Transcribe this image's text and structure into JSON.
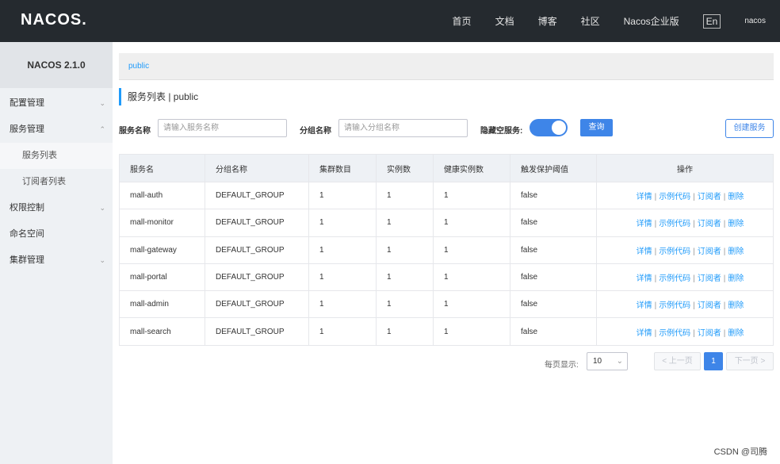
{
  "topbar": {
    "logo": "NACOS.",
    "nav": [
      "首页",
      "文档",
      "博客",
      "社区",
      "Nacos企业版"
    ],
    "lang": "En",
    "user": "nacos"
  },
  "sidebar": {
    "version": "NACOS 2.1.0",
    "items": [
      {
        "label": "配置管理",
        "chevron": "⌄"
      },
      {
        "label": "服务管理",
        "chevron": "⌃"
      },
      {
        "label": "服务列表"
      },
      {
        "label": "订阅者列表"
      },
      {
        "label": "权限控制",
        "chevron": "⌄"
      },
      {
        "label": "命名空间"
      },
      {
        "label": "集群管理",
        "chevron": "⌄"
      }
    ]
  },
  "main": {
    "breadcrumb": "public",
    "title": "服务列表 | public",
    "filters": {
      "service_label": "服务名称",
      "service_placeholder": "请输入服务名称",
      "group_label": "分组名称",
      "group_placeholder": "请输入分组名称",
      "hide_empty_label": "隐藏空服务:",
      "hide_empty_on": true,
      "query_button": "查询",
      "create_button": "创建服务"
    },
    "table": {
      "headers": [
        "服务名",
        "分组名称",
        "集群数目",
        "实例数",
        "健康实例数",
        "触发保护阈值",
        "操作"
      ],
      "rows": [
        [
          "mall-auth",
          "DEFAULT_GROUP",
          "1",
          "1",
          "1",
          "false"
        ],
        [
          "mall-monitor",
          "DEFAULT_GROUP",
          "1",
          "1",
          "1",
          "false"
        ],
        [
          "mall-gateway",
          "DEFAULT_GROUP",
          "1",
          "1",
          "1",
          "false"
        ],
        [
          "mall-portal",
          "DEFAULT_GROUP",
          "1",
          "1",
          "1",
          "false"
        ],
        [
          "mall-admin",
          "DEFAULT_GROUP",
          "1",
          "1",
          "1",
          "false"
        ],
        [
          "mall-search",
          "DEFAULT_GROUP",
          "1",
          "1",
          "1",
          "false"
        ]
      ],
      "ops": [
        "详情",
        "示例代码",
        "订阅者",
        "删除"
      ],
      "op_separator": "|"
    },
    "pagination": {
      "page_size_label": "每页显示:",
      "page_size": "10",
      "prev": "< 上一页",
      "current": "1",
      "next": "下一页 >"
    }
  },
  "watermark": "CSDN @司腾",
  "colors": {
    "topbar": "#252a2f",
    "accent": "#3e85e8",
    "link": "#209bfa",
    "sidebar": "#eef1f4"
  }
}
